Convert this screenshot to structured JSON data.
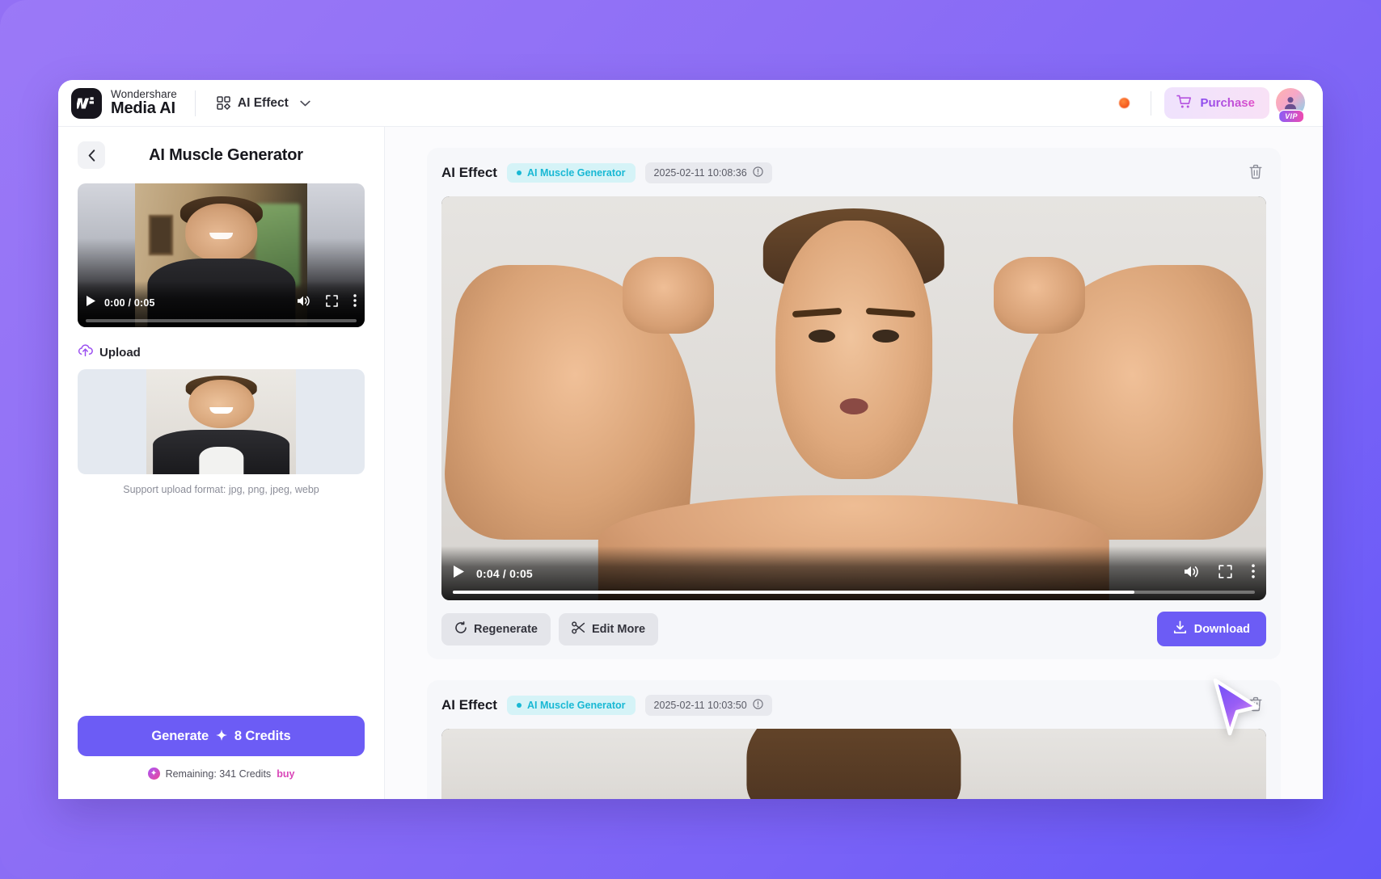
{
  "app": {
    "brand_top": "Wondershare",
    "brand_bottom": "Media AI",
    "nav_label": "AI Effect",
    "purchase_label": "Purchase",
    "vip_label": "VIP",
    "accent": "#6c5cf5",
    "icons": {
      "grid": "grid-icon",
      "chevron": "chevron-down-icon",
      "cart": "cart-icon",
      "record_dot": "record-dot-icon",
      "avatar": "avatar-icon"
    }
  },
  "sidebar": {
    "back": "back-icon",
    "title": "AI Muscle Generator",
    "preview_video": {
      "current_time": "0:00",
      "duration": "0:05",
      "time_display": "0:00 / 0:05",
      "progress_percent": 0
    },
    "upload": {
      "label": "Upload",
      "icon": "cloud-upload-icon",
      "support_text": "Support upload format: jpg, png, jpeg, webp"
    },
    "generate": {
      "label": "Generate",
      "spark": "✦",
      "cost": "8 Credits"
    },
    "credits": {
      "text": "Remaining: 341 Credits",
      "buy_label": "buy",
      "remaining": 341
    }
  },
  "main": {
    "cards": [
      {
        "title": "AI Effect",
        "effect_tag": "AI Muscle Generator",
        "timestamp": "2025-02-11 10:08:36",
        "delete_icon": "trash-icon",
        "video": {
          "current_time": "0:04",
          "duration": "0:05",
          "time_display": "0:04 / 0:05",
          "progress_percent": 85
        },
        "actions": {
          "regenerate": "Regenerate",
          "edit_more": "Edit More",
          "download": "Download"
        }
      },
      {
        "title": "AI Effect",
        "effect_tag": "AI Muscle Generator",
        "timestamp": "2025-02-11 10:03:50",
        "delete_icon": "trash-icon"
      }
    ]
  },
  "cursor": {
    "name": "mouse-cursor"
  }
}
